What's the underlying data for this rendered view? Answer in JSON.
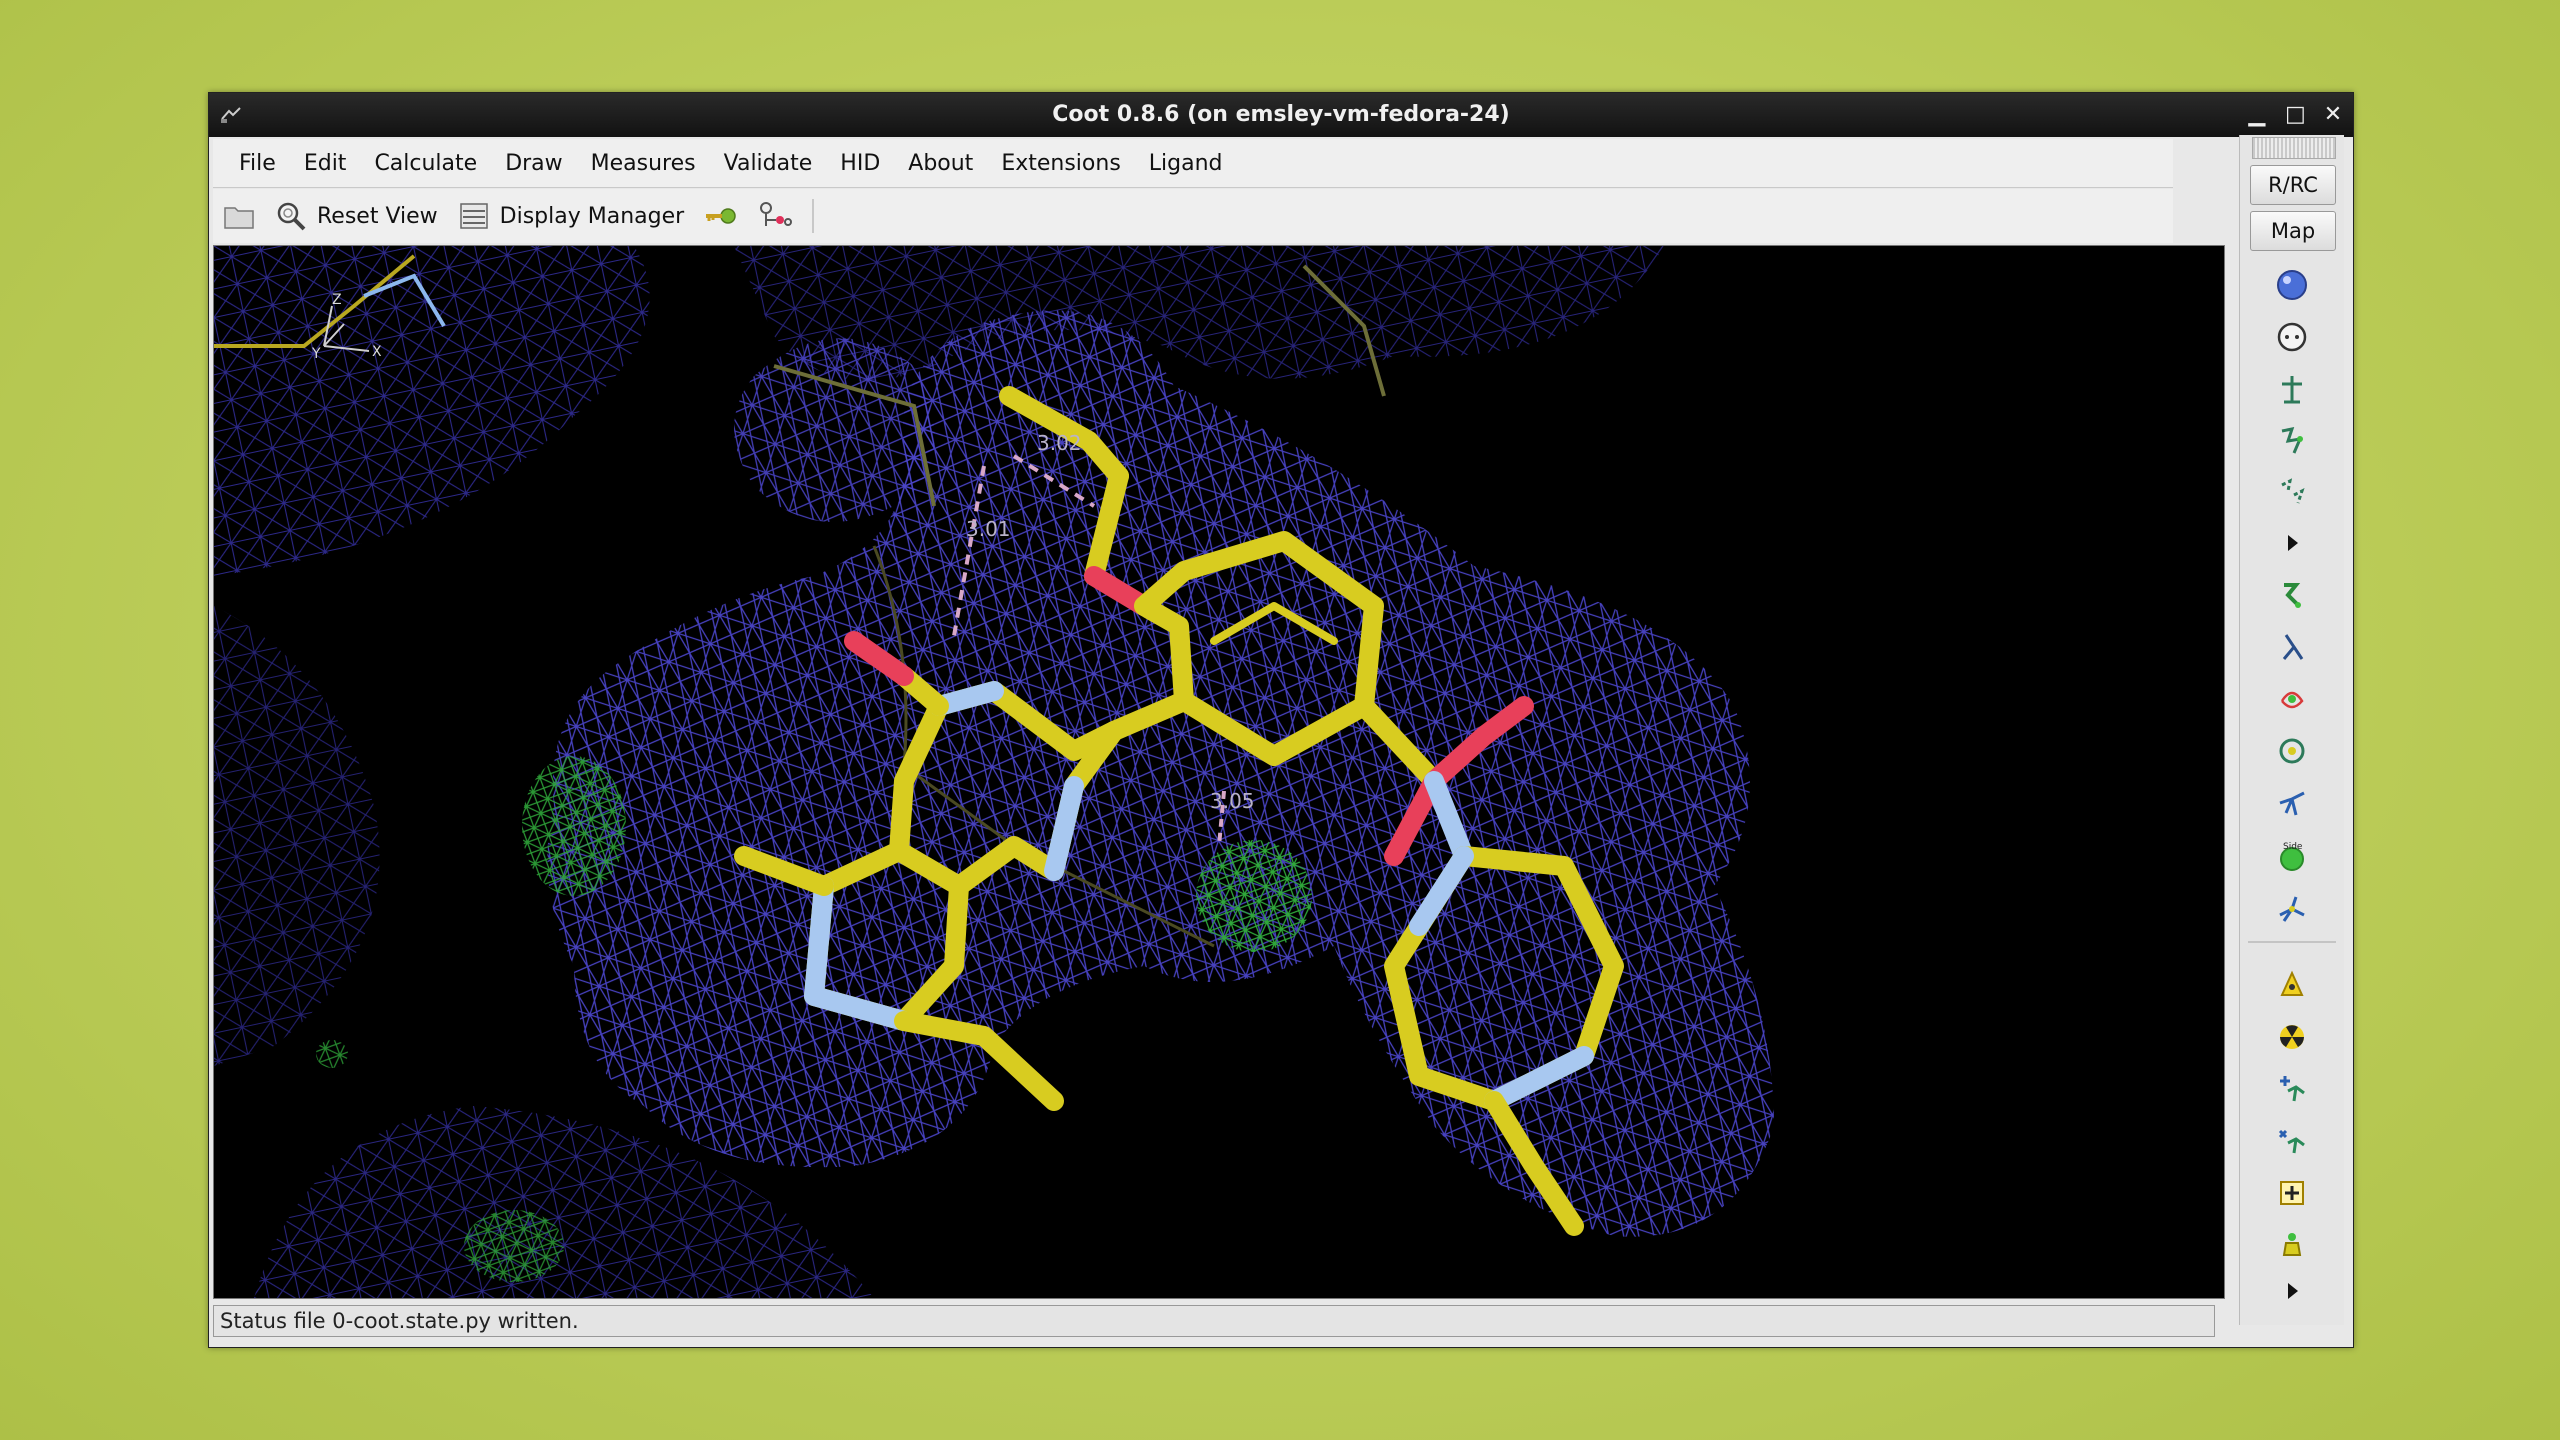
{
  "window": {
    "title": "Coot 0.8.6 (on emsley-vm-fedora-24)"
  },
  "menubar": {
    "items": [
      {
        "label": "File",
        "name": "menu-file"
      },
      {
        "label": "Edit",
        "name": "menu-edit"
      },
      {
        "label": "Calculate",
        "name": "menu-calculate"
      },
      {
        "label": "Draw",
        "name": "menu-draw"
      },
      {
        "label": "Measures",
        "name": "menu-measures"
      },
      {
        "label": "Validate",
        "name": "menu-validate"
      },
      {
        "label": "HID",
        "name": "menu-hid"
      },
      {
        "label": "About",
        "name": "menu-about"
      },
      {
        "label": "Extensions",
        "name": "menu-extensions"
      },
      {
        "label": "Ligand",
        "name": "menu-ligand"
      }
    ]
  },
  "toolbar": {
    "reset_view_label": "Reset View",
    "display_manager_label": "Display Manager"
  },
  "sidebar": {
    "rrc_label": "R/RC",
    "map_label": "Map",
    "icons": [
      "rotate-translate-icon",
      "auto-fit-rotamer-icon",
      "regularize-icon",
      "real-space-refine-icon",
      "rigid-body-fit-icon",
      "more-arrow-icon",
      "add-terminal-residue-icon",
      "flip-peptide-icon",
      "rotamers-icon",
      "torsion-icon",
      "pepflip-icon",
      "side-chain-180-icon",
      "mutate-icon",
      "add-atom-icon",
      "delete-icon",
      "add-alt-conf-icon",
      "delete-alt-conf-icon",
      "place-atom-icon",
      "water-icon",
      "more-arrow-bottom-icon"
    ]
  },
  "viewport": {
    "distance_labels": [
      "3.02",
      "3.01",
      "3.05"
    ],
    "axis_labels": [
      "Z",
      "Y",
      "X"
    ]
  },
  "status": {
    "text": "Status file 0-coot.state.py written."
  },
  "colors": {
    "background": "#000000",
    "mesh": "#4a44c8",
    "diff_mesh": "#2fa83a",
    "carbon": "#d8cc20",
    "nitrogen": "#a8c8f0",
    "oxygen": "#e8405a"
  }
}
